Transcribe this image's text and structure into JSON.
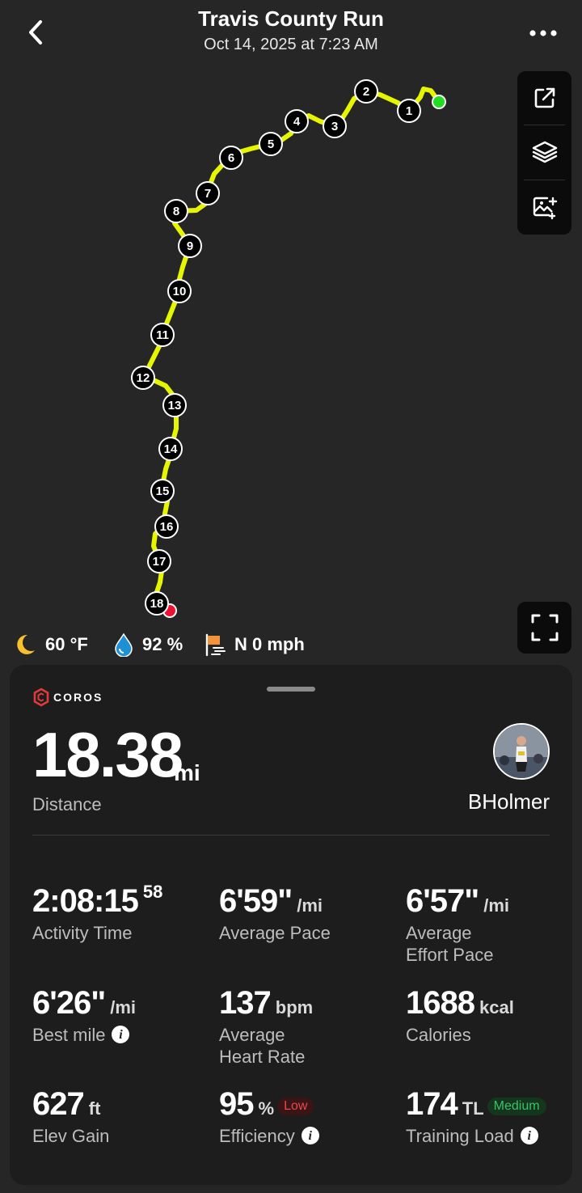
{
  "header": {
    "title": "Travis County Run",
    "subtitle": "Oct 14, 2025 at 7:23 AM"
  },
  "map": {
    "route_color": "#e6f500",
    "start_color": "#22dd22",
    "end_color": "#ee1133",
    "mile_markers": [
      "1",
      "2",
      "3",
      "4",
      "5",
      "6",
      "7",
      "8",
      "9",
      "10",
      "11",
      "12",
      "13",
      "14",
      "15",
      "16",
      "17",
      "18"
    ],
    "tools": [
      "share-icon",
      "layers-icon",
      "add-image-icon"
    ]
  },
  "weather": {
    "temperature": "60 °F",
    "humidity": "92 %",
    "wind": "N 0 mph"
  },
  "card": {
    "brand": "COROS",
    "distance": {
      "value": "18.38",
      "unit": "mi",
      "label": "Distance"
    },
    "user": {
      "name": "BHolmer"
    },
    "stats": {
      "activity_time": {
        "value": "2:08:15",
        "sup": "58",
        "label": "Activity Time"
      },
      "average_pace": {
        "value": "6'59\"",
        "unit": "/mi",
        "label": "Average Pace"
      },
      "effort_pace": {
        "value": "6'57\"",
        "unit": "/mi",
        "label_line1": "Average",
        "label_line2": "Effort Pace"
      },
      "best_mile": {
        "value": "6'26\"",
        "unit": "/mi",
        "label": "Best mile"
      },
      "heart_rate": {
        "value": "137",
        "unit": "bpm",
        "label_line1": "Average",
        "label_line2": "Heart Rate"
      },
      "calories": {
        "value": "1688",
        "unit": "kcal",
        "label": "Calories"
      },
      "elev_gain": {
        "value": "627",
        "unit": "ft",
        "label": "Elev Gain"
      },
      "efficiency": {
        "value": "95",
        "unit": "%",
        "badge": "Low",
        "label": "Efficiency"
      },
      "training_load": {
        "value": "174",
        "unit": "TL",
        "badge": "Medium",
        "label": "Training Load"
      }
    }
  }
}
